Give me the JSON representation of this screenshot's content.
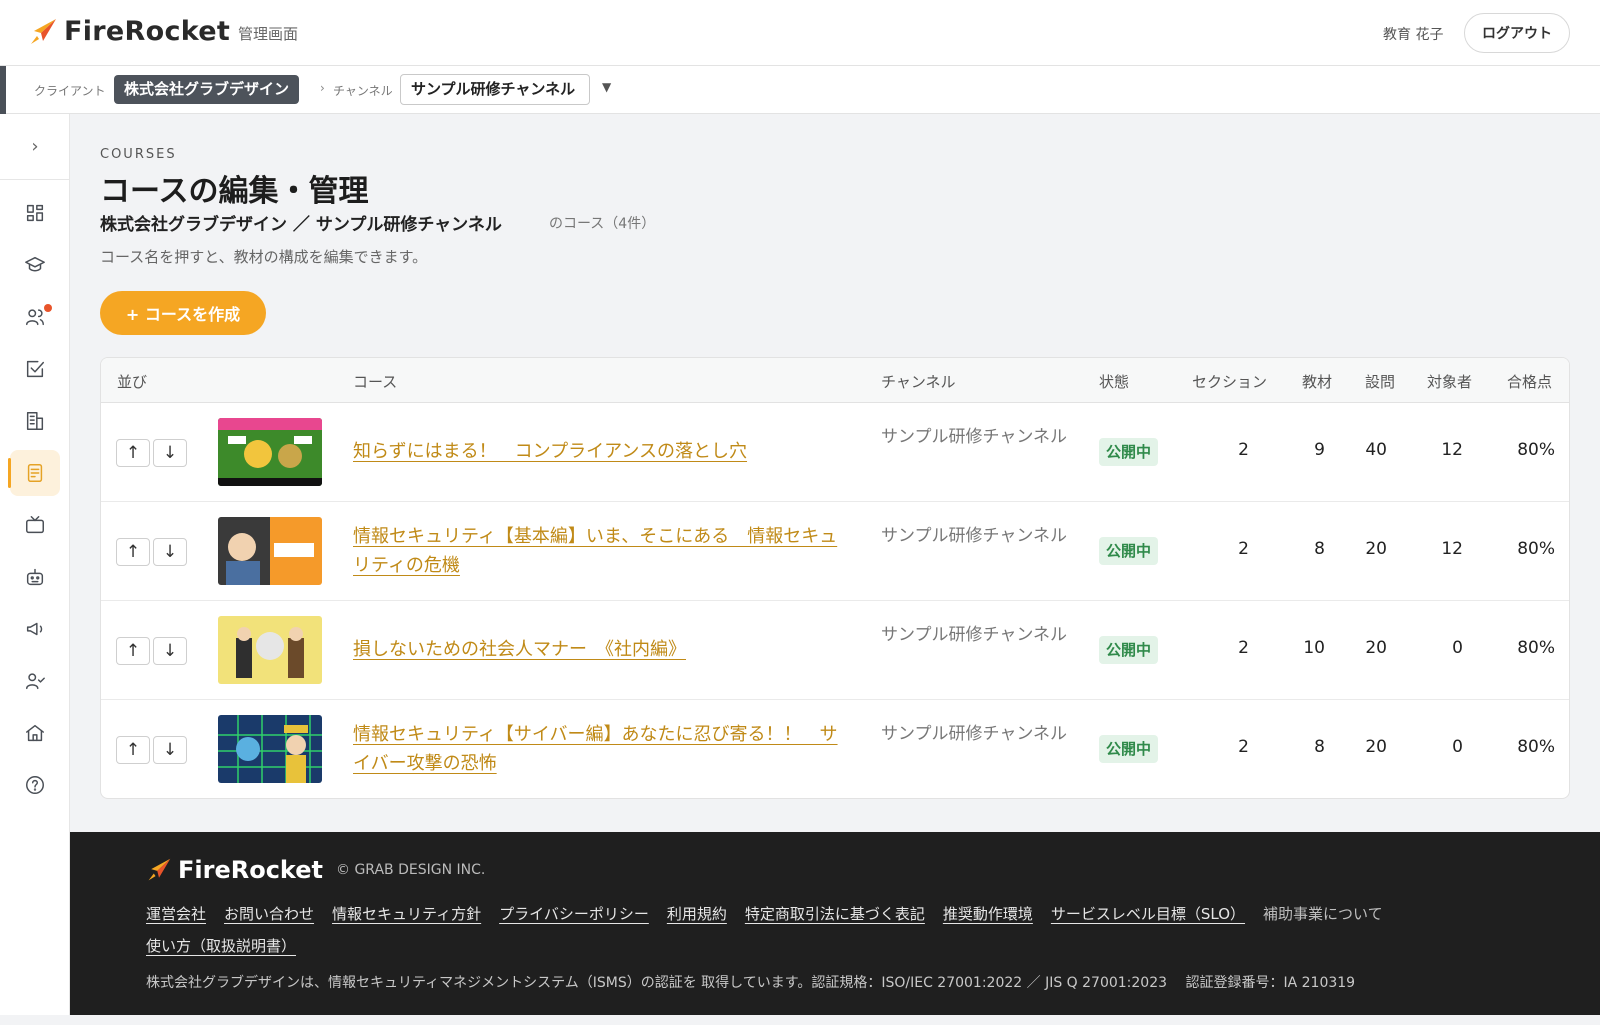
{
  "header": {
    "brand": "FireRocket",
    "admin_label": "管理画面",
    "user_name": "教育 花子",
    "logout_label": "ログアウト"
  },
  "context": {
    "client_label": "クライアント",
    "client_value": "株式会社グラブデザイン",
    "separator": "›",
    "channel_label": "チャンネル",
    "channel_value": "サンプル研修チャンネル",
    "caret": "▼"
  },
  "sidebar": {
    "toggle": "›",
    "items": [
      {
        "icon": "dashboard-icon"
      },
      {
        "icon": "graduation-cap-icon"
      },
      {
        "icon": "users-icon",
        "badge": true
      },
      {
        "icon": "checkbox-icon"
      },
      {
        "icon": "building-icon"
      },
      {
        "icon": "course-document-icon",
        "active": true
      },
      {
        "icon": "tv-icon"
      },
      {
        "icon": "robot-icon"
      },
      {
        "icon": "megaphone-icon"
      },
      {
        "icon": "user-check-icon"
      },
      {
        "icon": "home-icon"
      },
      {
        "icon": "help-icon"
      }
    ]
  },
  "main": {
    "eyebrow": "COURSES",
    "title": "コースの編集・管理",
    "scope": "株式会社グラブデザイン ／ サンプル研修チャンネル",
    "scope_suffix": "のコース（4件）",
    "hint": "コース名を押すと、教材の構成を編集できます。",
    "create_button": "+ コースを作成"
  },
  "table": {
    "headers": {
      "order": "並び",
      "course": "コース",
      "channel": "チャンネル",
      "status": "状態",
      "sections": "セクション",
      "materials": "教材",
      "questions": "設問",
      "targets": "対象者",
      "pass": "合格点"
    },
    "up": "↑",
    "down": "↓",
    "rows": [
      {
        "course": "知らずにはまる！　コンプライアンスの落とし穴",
        "channel": "サンプル研修チャンネル",
        "status": "公開中",
        "sections": "2",
        "materials": "9",
        "questions": "40",
        "targets": "12",
        "pass": "80%"
      },
      {
        "course": "情報セキュリティ【基本編】いま、そこにある　情報セキュリティの危機",
        "channel": "サンプル研修チャンネル",
        "status": "公開中",
        "sections": "2",
        "materials": "8",
        "questions": "20",
        "targets": "12",
        "pass": "80%"
      },
      {
        "course": "損しないための社会人マナー　《社内編》",
        "channel": "サンプル研修チャンネル",
        "status": "公開中",
        "sections": "2",
        "materials": "10",
        "questions": "20",
        "targets": "0",
        "pass": "80%"
      },
      {
        "course": "情報セキュリティ【サイバー編】あなたに忍び寄る！！　サイバー攻撃の恐怖",
        "channel": "サンプル研修チャンネル",
        "status": "公開中",
        "sections": "2",
        "materials": "8",
        "questions": "20",
        "targets": "0",
        "pass": "80%"
      }
    ]
  },
  "footer": {
    "brand": "FireRocket",
    "copyright": "© GRAB DESIGN INC.",
    "links": [
      "運営会社",
      "お問い合わせ",
      "情報セキュリティ方針",
      "プライバシーポリシー",
      "利用規約",
      "特定商取引法に基づく表記",
      "推奨動作環境",
      "サービスレベル目標（SLO）"
    ],
    "plain_link": "補助事業について",
    "links2": [
      "使い方（取扱説明書）"
    ],
    "isms": "株式会社グラブデザインは、情報セキュリティマネジメントシステム（ISMS）の認証を 取得しています。認証規格：ISO/IEC 27001:2022 ／ JIS Q 27001:2023　 認証登録番号：IA 210319"
  },
  "colors": {
    "accent": "#f5a623",
    "link": "#c08a17",
    "status_bg": "#e3f3e8",
    "status_text": "#2f8a4a",
    "footer_bg": "#1f1f1f"
  }
}
